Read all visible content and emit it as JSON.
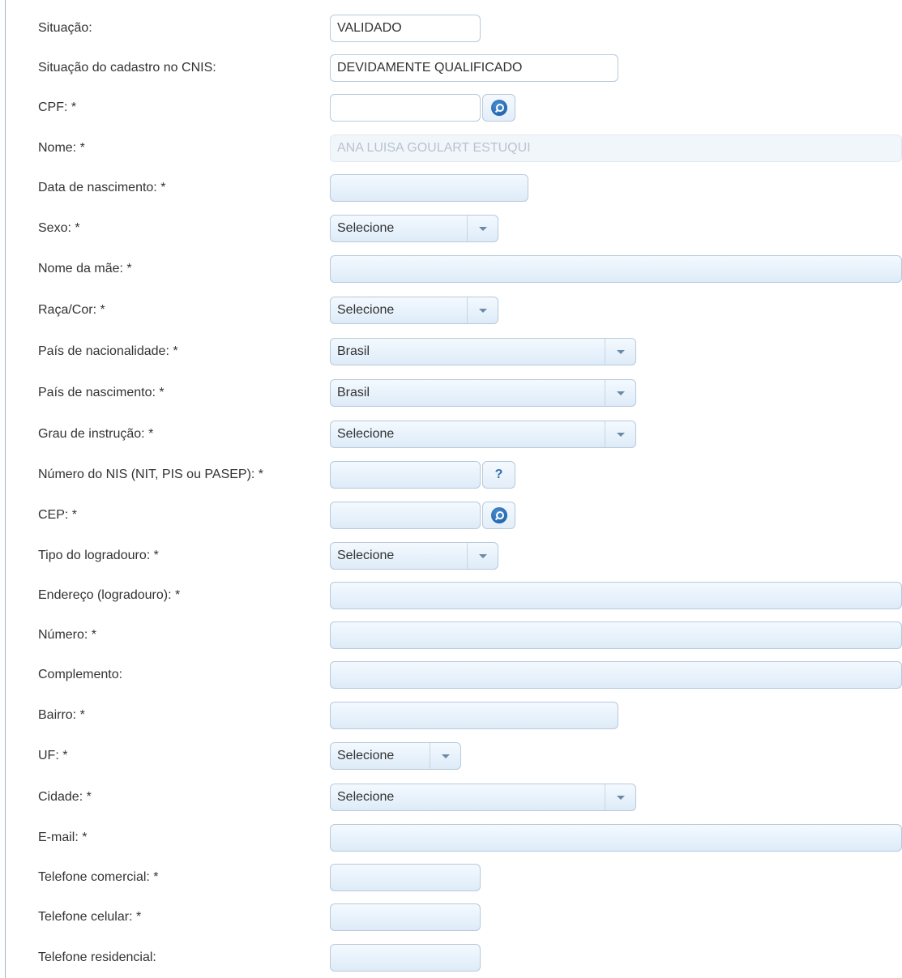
{
  "form": {
    "fields": [
      {
        "label": "Situação:",
        "value": "VALIDADO"
      },
      {
        "label": "Situação do cadastro no CNIS:",
        "value": "DEVIDAMENTE QUALIFICADO"
      },
      {
        "label": "CPF: *",
        "value": ""
      },
      {
        "label": "Nome: *",
        "value": "ANA LUISA GOULART ESTUQUI"
      },
      {
        "label": "Data de nascimento: *",
        "value": ""
      },
      {
        "label": "Sexo: *",
        "value": "Selecione"
      },
      {
        "label": "Nome da mãe: *",
        "value": ""
      },
      {
        "label": "Raça/Cor: *",
        "value": "Selecione"
      },
      {
        "label": "País de nacionalidade: *",
        "value": "Brasil"
      },
      {
        "label": "País de nascimento: *",
        "value": "Brasil"
      },
      {
        "label": "Grau de instrução: *",
        "value": "Selecione"
      },
      {
        "label": "Número do NIS (NIT, PIS ou PASEP): *",
        "value": ""
      },
      {
        "label": "CEP: *",
        "value": ""
      },
      {
        "label": "Tipo do logradouro: *",
        "value": "Selecione"
      },
      {
        "label": "Endereço (logradouro): *",
        "value": ""
      },
      {
        "label": "Número: *",
        "value": ""
      },
      {
        "label": "Complemento:",
        "value": ""
      },
      {
        "label": "Bairro: *",
        "value": ""
      },
      {
        "label": "UF: *",
        "value": "Selecione"
      },
      {
        "label": "Cidade: *",
        "value": "Selecione"
      },
      {
        "label": "E-mail: *",
        "value": ""
      },
      {
        "label": "Telefone comercial: *",
        "value": ""
      },
      {
        "label": "Telefone celular: *",
        "value": ""
      },
      {
        "label": "Telefone residencial:",
        "value": ""
      }
    ],
    "help_symbol": "?"
  },
  "icons": {
    "cpf_lookup": "search-icon",
    "cep_lookup": "search-icon",
    "nis_help": "help-icon"
  },
  "colors": {
    "field_border": "#b7cadb",
    "field_fill": "#e6f1fb",
    "search_icon": "#2a6db5",
    "help_icon": "#2f6fae"
  }
}
